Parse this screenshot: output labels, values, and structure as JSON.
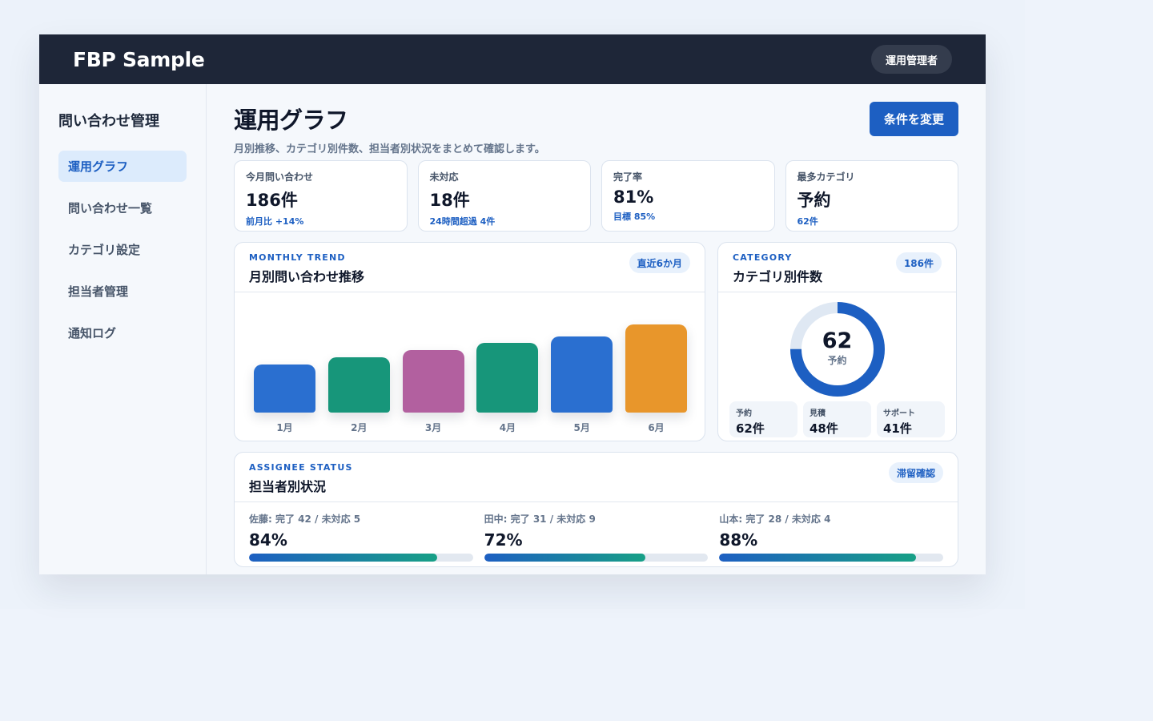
{
  "app": {
    "brand": "FBP Sample",
    "user_role": "運用管理者"
  },
  "sidebar": {
    "title": "問い合わせ管理",
    "items": [
      {
        "label": "運用グラフ",
        "active": true
      },
      {
        "label": "問い合わせ一覧",
        "active": false
      },
      {
        "label": "カテゴリ設定",
        "active": false
      },
      {
        "label": "担当者管理",
        "active": false
      },
      {
        "label": "通知ログ",
        "active": false
      }
    ]
  },
  "page": {
    "title": "運用グラフ",
    "subtitle": "月別推移、カテゴリ別件数、担当者別状況をまとめて確認します。",
    "change_button": "条件を変更"
  },
  "kpis": [
    {
      "label": "今月問い合わせ",
      "value": "186件",
      "note": "前月比 +14%"
    },
    {
      "label": "未対応",
      "value": "18件",
      "note": "24時間超過 4件"
    },
    {
      "label": "完了率",
      "value": "81%",
      "note": "目標 85%"
    },
    {
      "label": "最多カテゴリ",
      "value": "予約",
      "note": "62件"
    }
  ],
  "trend": {
    "eyebrow": "MONTHLY TREND",
    "title": "月別問い合わせ推移",
    "chip": "直近6か月"
  },
  "category": {
    "eyebrow": "CATEGORY",
    "title": "カテゴリ別件数",
    "chip": "186件",
    "donut_value": "62",
    "donut_label": "予約",
    "donut_fraction": 0.75,
    "items": [
      {
        "label": "予約",
        "value": "62件"
      },
      {
        "label": "見積",
        "value": "48件"
      },
      {
        "label": "サポート",
        "value": "41件"
      }
    ]
  },
  "assignees": {
    "eyebrow": "ASSIGNEE STATUS",
    "title": "担当者別状況",
    "chip": "滞留確認",
    "people": [
      {
        "label": "佐藤: 完了 42 / 未対応 5",
        "value": "84%",
        "rate": 0.84
      },
      {
        "label": "田中: 完了 31 / 未対応 9",
        "value": "72%",
        "rate": 0.72
      },
      {
        "label": "山本: 完了 28 / 未対応 4",
        "value": "88%",
        "rate": 0.88
      }
    ]
  },
  "chart_data": {
    "type": "bar",
    "categories": [
      "1月",
      "2月",
      "3月",
      "4月",
      "5月",
      "6月"
    ],
    "values": [
      110,
      125,
      142,
      158,
      172,
      200
    ],
    "ylim": [
      0,
      200
    ],
    "colors": [
      "#2a6fd0",
      "#17967a",
      "#b2609f",
      "#17967a",
      "#2a6fd0",
      "#e8962b"
    ]
  },
  "colors": {
    "accent": "#1d5fc2",
    "topbar": "#1e2638",
    "donut_track": "#dfe8f3"
  }
}
